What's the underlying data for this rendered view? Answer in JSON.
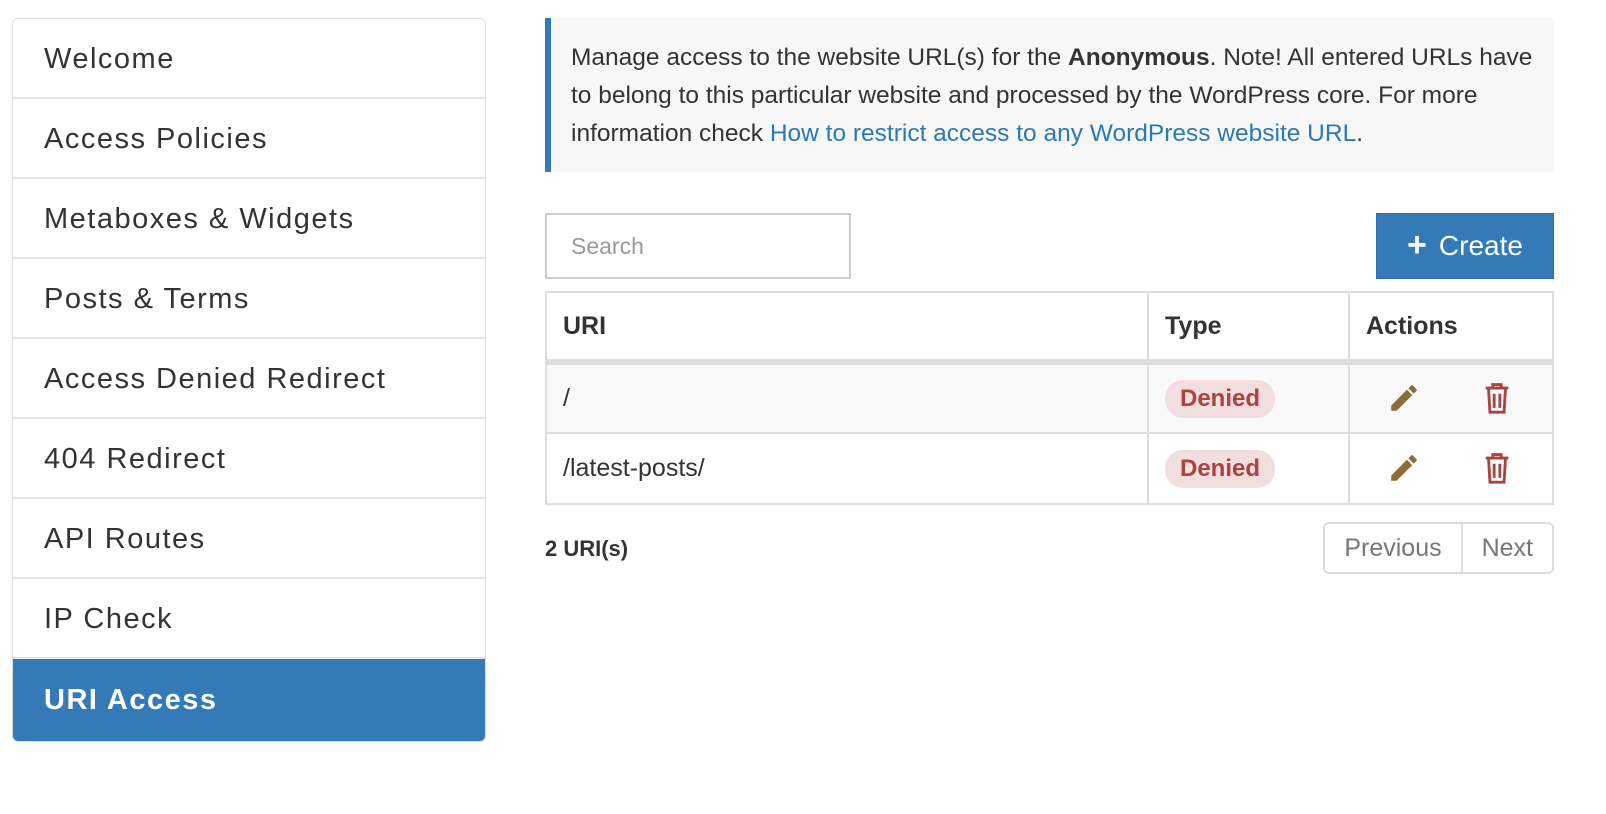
{
  "sidebar": {
    "items": [
      {
        "label": "Welcome"
      },
      {
        "label": "Access Policies"
      },
      {
        "label": "Metaboxes & Widgets"
      },
      {
        "label": "Posts & Terms"
      },
      {
        "label": "Access Denied Redirect"
      },
      {
        "label": "404 Redirect"
      },
      {
        "label": "API Routes"
      },
      {
        "label": "IP Check"
      },
      {
        "label": "URI Access",
        "active": true
      }
    ]
  },
  "callout": {
    "text_before": "Manage access to the website URL(s) for the ",
    "role": "Anonymous",
    "text_after": ". Note! All entered URLs have to belong to this particular website and processed by the WordPress core. For more information check ",
    "link_text": "How to restrict access to any WordPress website URL",
    "text_end": "."
  },
  "search": {
    "placeholder": "Search",
    "value": ""
  },
  "create_button": {
    "label": "Create",
    "icon": "plus-icon"
  },
  "table": {
    "headers": {
      "uri": "URI",
      "type": "Type",
      "actions": "Actions"
    },
    "rows": [
      {
        "uri": "/",
        "type": "Denied"
      },
      {
        "uri": "/latest-posts/",
        "type": "Denied"
      }
    ]
  },
  "footer": {
    "count": "2 URI(s)",
    "previous": "Previous",
    "next": "Next"
  },
  "colors": {
    "accent": "#337ab7",
    "badge_bg": "#f2dede",
    "badge_text": "#a94442",
    "edit_icon": "#8a6d3b",
    "delete_icon": "#a94442"
  }
}
